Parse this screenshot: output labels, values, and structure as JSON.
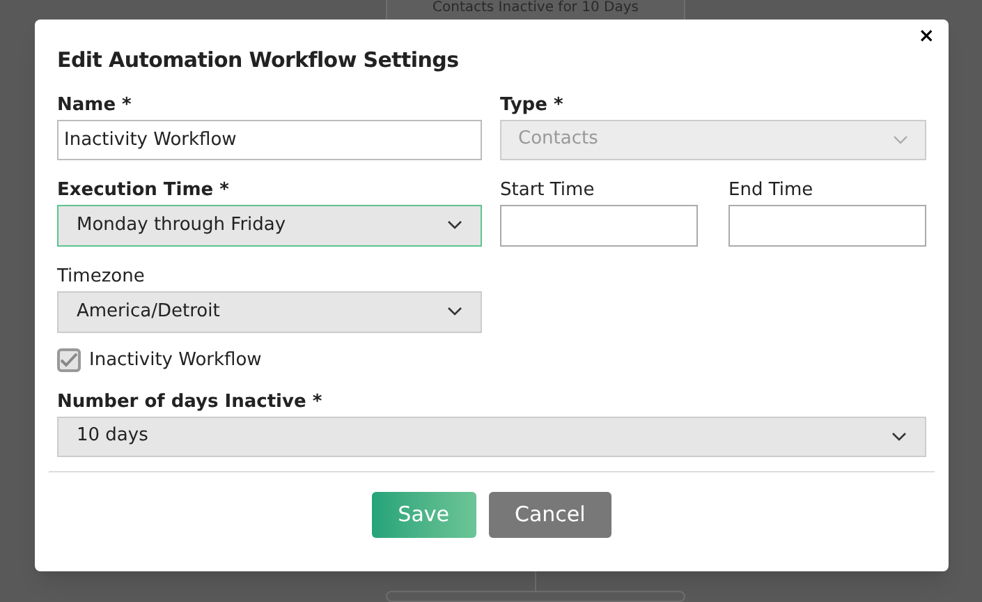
{
  "background": {
    "card_subtitle": "Contacts Inactive for 10 Days"
  },
  "dialog": {
    "title": "Edit Automation Workflow Settings",
    "close": "×",
    "name": {
      "label": "Name *",
      "value": "Inactivity Workflow"
    },
    "type": {
      "label": "Type *",
      "value": "Contacts",
      "disabled": true
    },
    "execution_time": {
      "label": "Execution Time *",
      "value": "Monday through Friday",
      "focused": true
    },
    "start_time": {
      "label": "Start Time"
    },
    "end_time": {
      "label": "End Time"
    },
    "timezone": {
      "label": "Timezone",
      "value": "America/Detroit"
    },
    "inactivity_checkbox": {
      "label": "Inactivity Workflow",
      "checked": true
    },
    "days_inactive": {
      "label": "Number of days Inactive *",
      "value": "10 days"
    },
    "buttons": [
      {
        "label": "Save",
        "kind": "primary"
      },
      {
        "label": "Cancel",
        "kind": "secondary"
      }
    ]
  }
}
